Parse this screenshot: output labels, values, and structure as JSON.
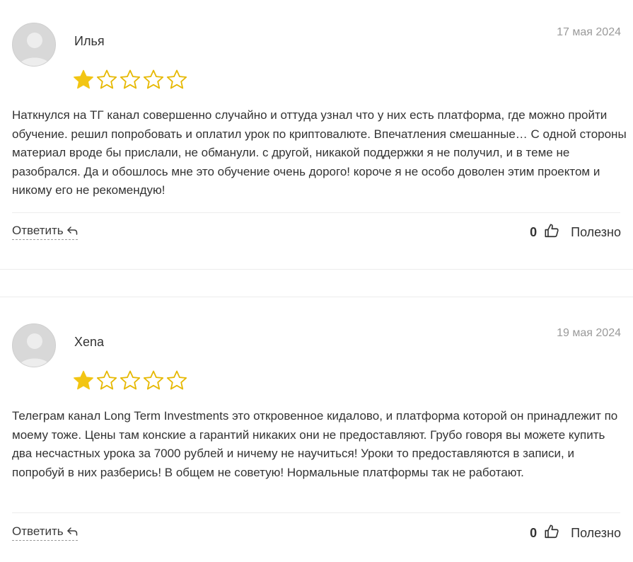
{
  "reviews": [
    {
      "author": "Илья",
      "date": "17 мая 2024",
      "rating": 1,
      "max_rating": 5,
      "text": "Наткнулся на ТГ канал совершенно случайно и оттуда узнал что у них есть платформа, где можно пройти обучение. решил попробовать и оплатил урок по криптовалюте. Впечатления смешанные… С одной стороны материал вроде бы прислали, не обманули. с другой, никакой поддержки я не получил, и в теме не разобрался. Да и обошлось мне это обучение очень дорого! короче я не особо доволен этим проектом и никому его не рекомендую!",
      "reply_label": "Ответить",
      "likes": "0",
      "helpful_label": "Полезно"
    },
    {
      "author": "Xena",
      "date": "19 мая 2024",
      "rating": 1,
      "max_rating": 5,
      "text": "Телеграм канал Long Term Investments это откровенное кидалово, и платформа которой он принадлежит по моему тоже. Цены там конские а гарантий никаких они не предоставляют. Грубо говоря вы можете купить два несчастных урока за 7000 рублей и ничему не научиться! Уроки то предоставляются в записи, и попробуй в них разберись! В общем не советую! Нормальные платформы так не работают.",
      "reply_label": "Ответить",
      "likes": "0",
      "helpful_label": "Полезно"
    }
  ],
  "colors": {
    "star_filled": "#f2c514",
    "star_empty_stroke": "#e6b800",
    "avatar_bg": "#d8d8d8",
    "date": "#9a9a9a"
  },
  "icons": {
    "avatar": "default-user-icon",
    "star": "star-icon",
    "reply": "reply-arrow-icon",
    "like": "thumbs-up-icon"
  }
}
